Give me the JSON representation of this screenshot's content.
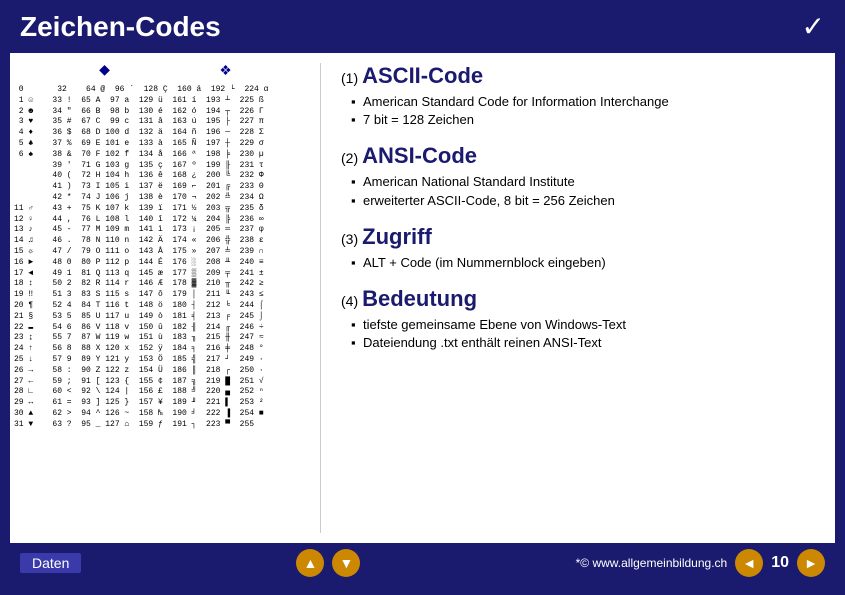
{
  "header": {
    "title": "Zeichen-Codes",
    "checkmark": "✓"
  },
  "left_icons": {
    "diamond1": "◆",
    "diamond2": "❖"
  },
  "ascii_table_text": " 0       32    64 @  96 `  128 Ç  160 á  192 └  224 α\n 1 ☺    33 !  65 A  97 a  129 ü  161 í  193 ┴  225 ß\n 2 ☻    34 \"  66 B  98 b  130 é  162 ó  194 ┬  226 Γ\n 3 ♥    35 #  67 C  99 c  131 â  163 ú  195 ├  227 π\n 4 ♦    36 $  68 D 100 d  132 ä  164 ñ  196 ─  228 Σ\n 5 ♣    37 %  69 E 101 e  133 à  165 Ñ  197 ┼  229 σ\n 6 ♠    38 &  70 F 102 f  134 å  166 ª  198 ╞  230 µ\n        39 '  71 G 103 g  135 ç  167 º  199 ╟  231 τ\n        40 (  72 H 104 h  136 ê  168 ¿  200 ╚  232 Φ\n        41 )  73 I 105 i  137 ë  169 ⌐  201 ╔  233 Θ\n        42 *  74 J 106 j  138 è  170 ¬  202 ╩  234 Ω\n11 ♂    43 +  75 K 107 k  139 ï  171 ½  203 ╦  235 δ\n12 ♀    44 ,  76 L 108 l  140 î  172 ¼  204 ╠  236 ∞\n13 ♪    45 -  77 M 109 m  141 ì  173 ¡  205 ═  237 φ\n14 ♫    46 .  78 N 110 n  142 Ä  174 «  206 ╬  238 ε\n15 ☼    47 /  79 O 111 o  143 Å  175 »  207 ╧  239 ∩\n16 ►    48 0  80 P 112 p  144 É  176 ░  208 ╨  240 ≡\n17 ◄    49 1  81 Q 113 q  145 æ  177 ▒  209 ╤  241 ±\n18 ↕    50 2  82 R 114 r  146 Æ  178 ▓  210 ╥  242 ≥\n19 ‼    51 3  83 S 115 s  147 ô  179 │  211 ╙  243 ≤\n20 ¶    52 4  84 T 116 t  148 ö  180 ┤  212 ╘  244 ⌠\n21 §    53 5  85 U 117 u  149 ò  181 ╡  213 ╒  245 ⌡\n22 ▬    54 6  86 V 118 v  150 û  182 ╢  214 ╓  246 ÷\n23 ↨    55 7  87 W 119 w  151 ù  183 ╖  215 ╫  247 ≈\n24 ↑    56 8  88 X 120 x  152 ÿ  184 ╕  216 ╪  248 °\n25 ↓    57 9  89 Y 121 y  153 Ö  185 ╣  217 ┘  249 ·\n26 →    58 :  90 Z 122 z  154 Ü  186 ║  218 ┌  250 ·\n27 ←    59 ;  91 [ 123 {  155 ¢  187 ╗  219 █  251 √\n28 ∟    60 <  92 \\ 124 |  156 £  188 ╝  220 ▄  252 ⁿ\n29 ↔    61 =  93 ] 125 }  157 ¥  189 ╜  221 ▌  253 ²\n30 ▲    62 >  94 ^ 126 ~  158 ₧  190 ╛  222 ▐  254 ■\n31 ▼    63 ?  95 _ 127 ⌂  159 ƒ  191 ┐  223 ▀  255",
  "sections": [
    {
      "number": "(1)",
      "heading": "ASCII-Code",
      "items": [
        "American Standard Code for Information Interchange",
        "7 bit = 128 Zeichen"
      ]
    },
    {
      "number": "(2)",
      "heading": "ANSI-Code",
      "items": [
        "American National Standard Institute",
        "erweiterter ASCII-Code, 8 bit = 256 Zeichen"
      ]
    },
    {
      "number": "(3)",
      "heading": "Zugriff",
      "items": [
        "ALT + Code (im Nummernblock eingeben)"
      ]
    },
    {
      "number": "(4)",
      "heading": "Bedeutung",
      "items": [
        "tiefste gemeinsame Ebene von Windows-Text",
        "Dateiendung .txt enthält reinen ANSI-Text"
      ]
    }
  ],
  "footer": {
    "label": "Daten",
    "nav_up": "▲",
    "nav_down": "▼",
    "copyright": "*© www.allgemeinbildung.ch",
    "page_prev": "◄",
    "page_num": "10",
    "page_next": "►"
  }
}
